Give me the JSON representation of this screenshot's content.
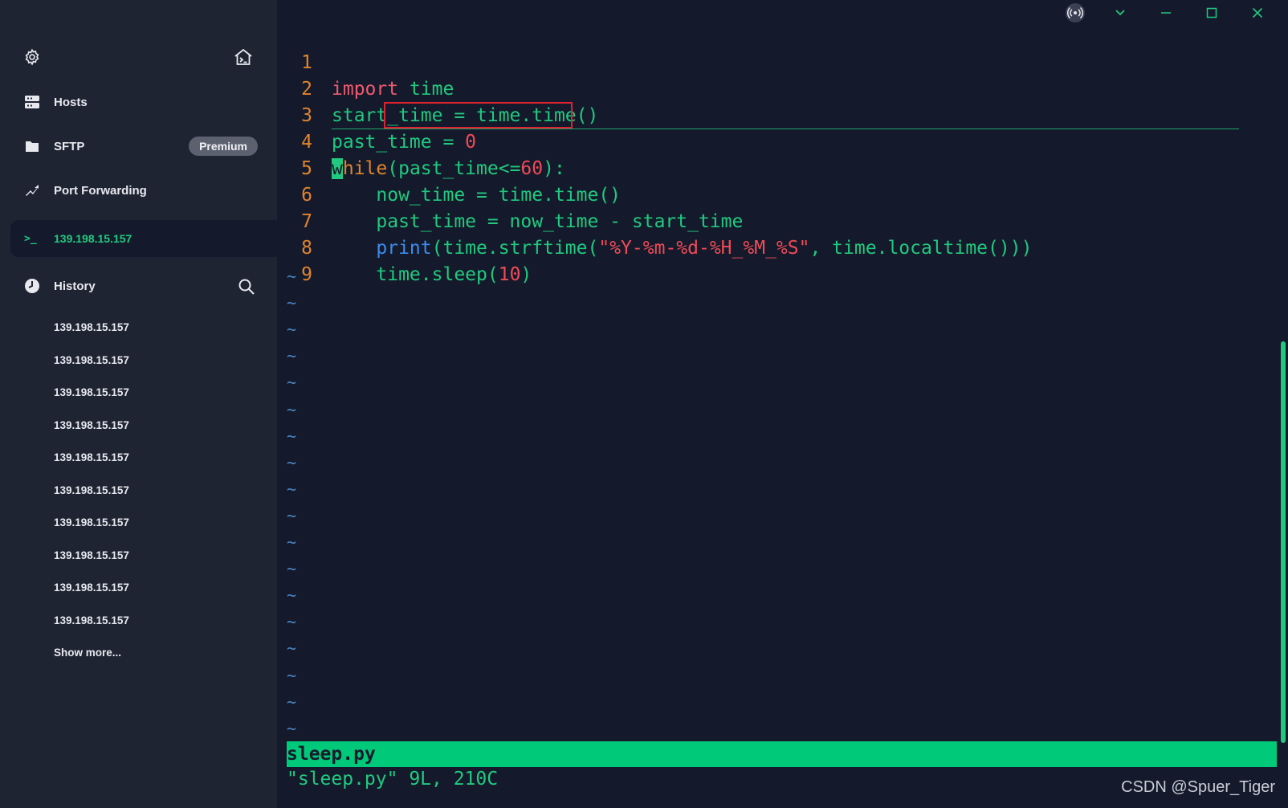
{
  "sidebar": {
    "settings_icon": "gear-icon",
    "home_icon": "home-terminal-icon",
    "nav": {
      "hosts": "Hosts",
      "sftp": "SFTP",
      "premium_badge": "Premium",
      "port_forwarding": "Port Forwarding"
    },
    "active_session": "139.198.15.157",
    "history": {
      "label": "History",
      "items": [
        "139.198.15.157",
        "139.198.15.157",
        "139.198.15.157",
        "139.198.15.157",
        "139.198.15.157",
        "139.198.15.157",
        "139.198.15.157",
        "139.198.15.157",
        "139.198.15.157",
        "139.198.15.157"
      ],
      "show_more": "Show more..."
    }
  },
  "terminal": {
    "line_numbers": [
      "1",
      "2",
      "3",
      "4",
      "5",
      "6",
      "7",
      "8",
      "9"
    ],
    "status_filename": "sleep.py",
    "message": "\"sleep.py\" 9L, 210C",
    "tilde": "~"
  },
  "colors": {
    "accent_green": "#00c97a",
    "keyword_red": "#ef5a6f",
    "number_orange": "#e0842e",
    "builtin_blue": "#3c8cf0",
    "highlight_box": "#e0212f"
  },
  "watermark": "CSDN @Spuer_Tiger"
}
